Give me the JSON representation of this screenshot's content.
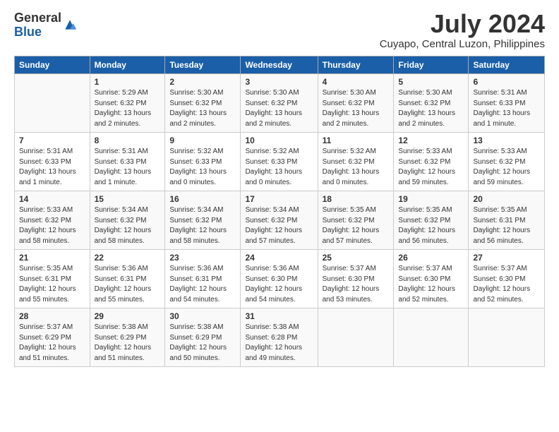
{
  "logo": {
    "general": "General",
    "blue": "Blue"
  },
  "title": "July 2024",
  "location": "Cuyapo, Central Luzon, Philippines",
  "headers": [
    "Sunday",
    "Monday",
    "Tuesday",
    "Wednesday",
    "Thursday",
    "Friday",
    "Saturday"
  ],
  "weeks": [
    [
      {
        "day": "",
        "info": ""
      },
      {
        "day": "1",
        "info": "Sunrise: 5:29 AM\nSunset: 6:32 PM\nDaylight: 13 hours\nand 2 minutes."
      },
      {
        "day": "2",
        "info": "Sunrise: 5:30 AM\nSunset: 6:32 PM\nDaylight: 13 hours\nand 2 minutes."
      },
      {
        "day": "3",
        "info": "Sunrise: 5:30 AM\nSunset: 6:32 PM\nDaylight: 13 hours\nand 2 minutes."
      },
      {
        "day": "4",
        "info": "Sunrise: 5:30 AM\nSunset: 6:32 PM\nDaylight: 13 hours\nand 2 minutes."
      },
      {
        "day": "5",
        "info": "Sunrise: 5:30 AM\nSunset: 6:32 PM\nDaylight: 13 hours\nand 2 minutes."
      },
      {
        "day": "6",
        "info": "Sunrise: 5:31 AM\nSunset: 6:33 PM\nDaylight: 13 hours\nand 1 minute."
      }
    ],
    [
      {
        "day": "7",
        "info": "Sunrise: 5:31 AM\nSunset: 6:33 PM\nDaylight: 13 hours\nand 1 minute."
      },
      {
        "day": "8",
        "info": "Sunrise: 5:31 AM\nSunset: 6:33 PM\nDaylight: 13 hours\nand 1 minute."
      },
      {
        "day": "9",
        "info": "Sunrise: 5:32 AM\nSunset: 6:33 PM\nDaylight: 13 hours\nand 0 minutes."
      },
      {
        "day": "10",
        "info": "Sunrise: 5:32 AM\nSunset: 6:33 PM\nDaylight: 13 hours\nand 0 minutes."
      },
      {
        "day": "11",
        "info": "Sunrise: 5:32 AM\nSunset: 6:32 PM\nDaylight: 13 hours\nand 0 minutes."
      },
      {
        "day": "12",
        "info": "Sunrise: 5:33 AM\nSunset: 6:32 PM\nDaylight: 12 hours\nand 59 minutes."
      },
      {
        "day": "13",
        "info": "Sunrise: 5:33 AM\nSunset: 6:32 PM\nDaylight: 12 hours\nand 59 minutes."
      }
    ],
    [
      {
        "day": "14",
        "info": "Sunrise: 5:33 AM\nSunset: 6:32 PM\nDaylight: 12 hours\nand 58 minutes."
      },
      {
        "day": "15",
        "info": "Sunrise: 5:34 AM\nSunset: 6:32 PM\nDaylight: 12 hours\nand 58 minutes."
      },
      {
        "day": "16",
        "info": "Sunrise: 5:34 AM\nSunset: 6:32 PM\nDaylight: 12 hours\nand 58 minutes."
      },
      {
        "day": "17",
        "info": "Sunrise: 5:34 AM\nSunset: 6:32 PM\nDaylight: 12 hours\nand 57 minutes."
      },
      {
        "day": "18",
        "info": "Sunrise: 5:35 AM\nSunset: 6:32 PM\nDaylight: 12 hours\nand 57 minutes."
      },
      {
        "day": "19",
        "info": "Sunrise: 5:35 AM\nSunset: 6:32 PM\nDaylight: 12 hours\nand 56 minutes."
      },
      {
        "day": "20",
        "info": "Sunrise: 5:35 AM\nSunset: 6:31 PM\nDaylight: 12 hours\nand 56 minutes."
      }
    ],
    [
      {
        "day": "21",
        "info": "Sunrise: 5:35 AM\nSunset: 6:31 PM\nDaylight: 12 hours\nand 55 minutes."
      },
      {
        "day": "22",
        "info": "Sunrise: 5:36 AM\nSunset: 6:31 PM\nDaylight: 12 hours\nand 55 minutes."
      },
      {
        "day": "23",
        "info": "Sunrise: 5:36 AM\nSunset: 6:31 PM\nDaylight: 12 hours\nand 54 minutes."
      },
      {
        "day": "24",
        "info": "Sunrise: 5:36 AM\nSunset: 6:30 PM\nDaylight: 12 hours\nand 54 minutes."
      },
      {
        "day": "25",
        "info": "Sunrise: 5:37 AM\nSunset: 6:30 PM\nDaylight: 12 hours\nand 53 minutes."
      },
      {
        "day": "26",
        "info": "Sunrise: 5:37 AM\nSunset: 6:30 PM\nDaylight: 12 hours\nand 52 minutes."
      },
      {
        "day": "27",
        "info": "Sunrise: 5:37 AM\nSunset: 6:30 PM\nDaylight: 12 hours\nand 52 minutes."
      }
    ],
    [
      {
        "day": "28",
        "info": "Sunrise: 5:37 AM\nSunset: 6:29 PM\nDaylight: 12 hours\nand 51 minutes."
      },
      {
        "day": "29",
        "info": "Sunrise: 5:38 AM\nSunset: 6:29 PM\nDaylight: 12 hours\nand 51 minutes."
      },
      {
        "day": "30",
        "info": "Sunrise: 5:38 AM\nSunset: 6:29 PM\nDaylight: 12 hours\nand 50 minutes."
      },
      {
        "day": "31",
        "info": "Sunrise: 5:38 AM\nSunset: 6:28 PM\nDaylight: 12 hours\nand 49 minutes."
      },
      {
        "day": "",
        "info": ""
      },
      {
        "day": "",
        "info": ""
      },
      {
        "day": "",
        "info": ""
      }
    ]
  ]
}
